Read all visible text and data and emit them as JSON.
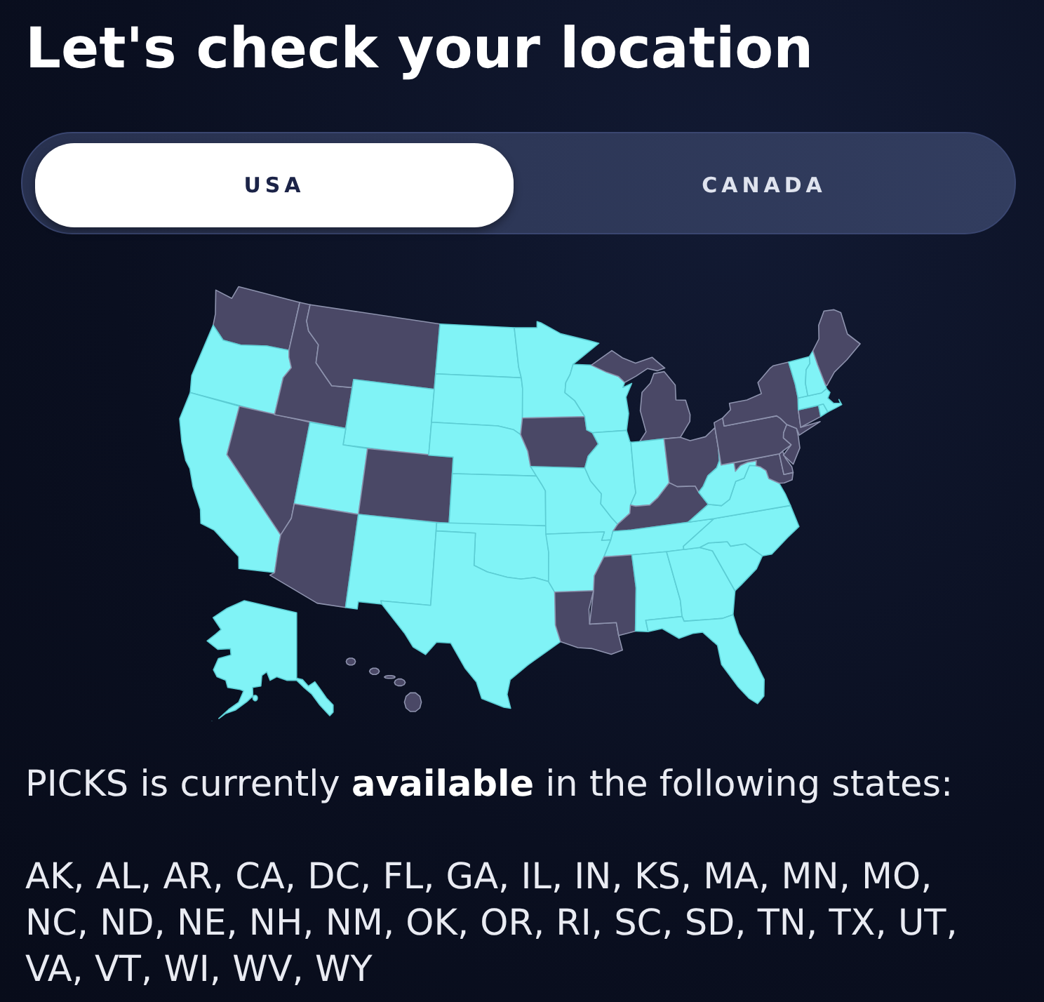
{
  "title": "Let's check your location",
  "country_tabs": [
    {
      "label": "USA",
      "selected": true
    },
    {
      "label": "CANADA",
      "selected": false
    }
  ],
  "map": {
    "regions": [
      {
        "available": false
      },
      {
        "available": true
      },
      {
        "available": true
      },
      {
        "available": false
      },
      {
        "available": false
      },
      {
        "available": false
      },
      {
        "available": true
      },
      {
        "available": true
      },
      {
        "available": false
      },
      {
        "available": false
      },
      {
        "available": true
      },
      {
        "available": true
      },
      {
        "available": true
      },
      {
        "available": true
      },
      {
        "available": true
      },
      {
        "available": true
      },
      {
        "available": true
      },
      {
        "available": true
      },
      {
        "available": false
      },
      {
        "available": true
      },
      {
        "available": true
      },
      {
        "available": false
      },
      {
        "available": true
      },
      {
        "available": true
      },
      {
        "available": false
      },
      {
        "available": true
      },
      {
        "available": false
      },
      {
        "available": false
      },
      {
        "available": true
      },
      {
        "available": false
      },
      {
        "available": true
      },
      {
        "available": true
      },
      {
        "available": true
      },
      {
        "available": true
      },
      {
        "available": true
      },
      {
        "available": true
      },
      {
        "available": true
      },
      {
        "available": false
      },
      {
        "available": false
      },
      {
        "available": false
      },
      {
        "available": false
      },
      {
        "available": false
      },
      {
        "available": false
      },
      {
        "available": true
      },
      {
        "available": true
      },
      {
        "available": true
      },
      {
        "available": true
      },
      {
        "available": false
      },
      {
        "available": true
      },
      {
        "available": false
      }
    ]
  },
  "availability_note": "PICKS is currently **available** in the following states:",
  "available_states": "AK, AL, AR, CA, DC, FL, GA, IL, IN, KS, MA, MN, MO, NC, ND, NE, NH, NM, OK, OR, RI, SC, SD, TN, TX, UT, VA, VT, WI, WV, WY"
}
